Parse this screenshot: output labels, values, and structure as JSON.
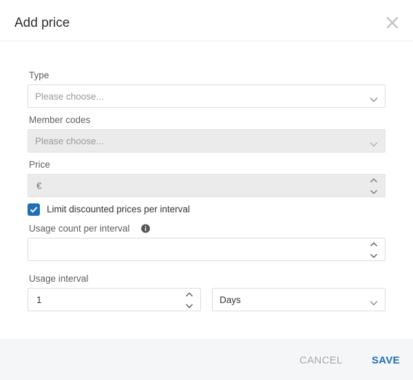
{
  "dialog": {
    "title": "Add price",
    "close_icon": "close-icon"
  },
  "form": {
    "type": {
      "label": "Type",
      "placeholder": "Please choose..."
    },
    "member_codes": {
      "label": "Member codes",
      "placeholder": "Please choose..."
    },
    "price": {
      "label": "Price",
      "prefix": "€",
      "value": ""
    },
    "limit_discounted": {
      "label": "Limit discounted prices per interval",
      "checked": true
    },
    "usage_count": {
      "label": "Usage count per interval",
      "value": "",
      "info_icon": "info-icon"
    },
    "usage_interval": {
      "label": "Usage interval",
      "value": "1",
      "unit": "Days"
    }
  },
  "footer": {
    "cancel_label": "CANCEL",
    "save_label": "SAVE"
  },
  "colors": {
    "accent": "#1f6fb5",
    "disabled_bg": "#ebebeb",
    "footer_bg": "#f5f6f7"
  }
}
